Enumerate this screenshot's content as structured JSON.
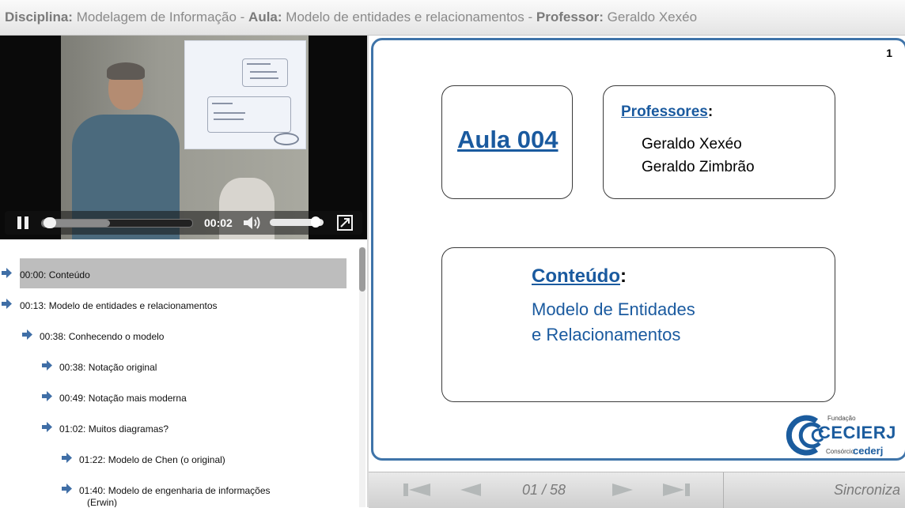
{
  "header": {
    "disciplina_label": "Disciplina:",
    "disciplina_value": "Modelagem de Informação",
    "aula_label": "Aula:",
    "aula_value": "Modelo de entidades e relacionamentos",
    "professor_label": "Professor:",
    "professor_value": "Geraldo Xexéo",
    "sep": " - "
  },
  "player": {
    "time": "00:02",
    "progress": 0.01,
    "buffered": 0.45,
    "volume": 0.92
  },
  "chapters": [
    {
      "label": "00:00: Conteúdo",
      "level": 0,
      "selected": true
    },
    {
      "label": "00:13: Modelo de entidades e relacionamentos",
      "level": 0
    },
    {
      "label": "00:38: Conhecendo o modelo",
      "level": 1
    },
    {
      "label": "00:38: Notação original",
      "level": 2
    },
    {
      "label": "00:49: Notação mais moderna",
      "level": 2
    },
    {
      "label": "01:02: Muitos diagramas?",
      "level": 2
    },
    {
      "label": "01:22: Modelo de Chen (o original)",
      "level": 3
    },
    {
      "label": "01:40: Modelo de engenharia de informações",
      "level": 3
    },
    {
      "label": "(Erwin)",
      "level": 3,
      "continuation": true
    }
  ],
  "slide": {
    "page": "1",
    "aula": "Aula 004",
    "professores_label": "Professores",
    "colon": ":",
    "professores": [
      "Geraldo Xexéo",
      "Geraldo Zimbrão"
    ],
    "conteudo_label": "Conteúdo",
    "conteudo_lines": [
      "Modelo de Entidades",
      "e Relacionamentos"
    ],
    "logo": {
      "fundacao": "Fundação",
      "name": "CECIERJ",
      "consorcio": "Consórcio",
      "cederj": "cederj"
    }
  },
  "nav": {
    "pager": "01 / 58",
    "sync": "Sincroniza"
  },
  "colors": {
    "accent": "#1a5a9f",
    "slide_border": "#3f74a9",
    "selected_row": "#bdbdbd"
  }
}
